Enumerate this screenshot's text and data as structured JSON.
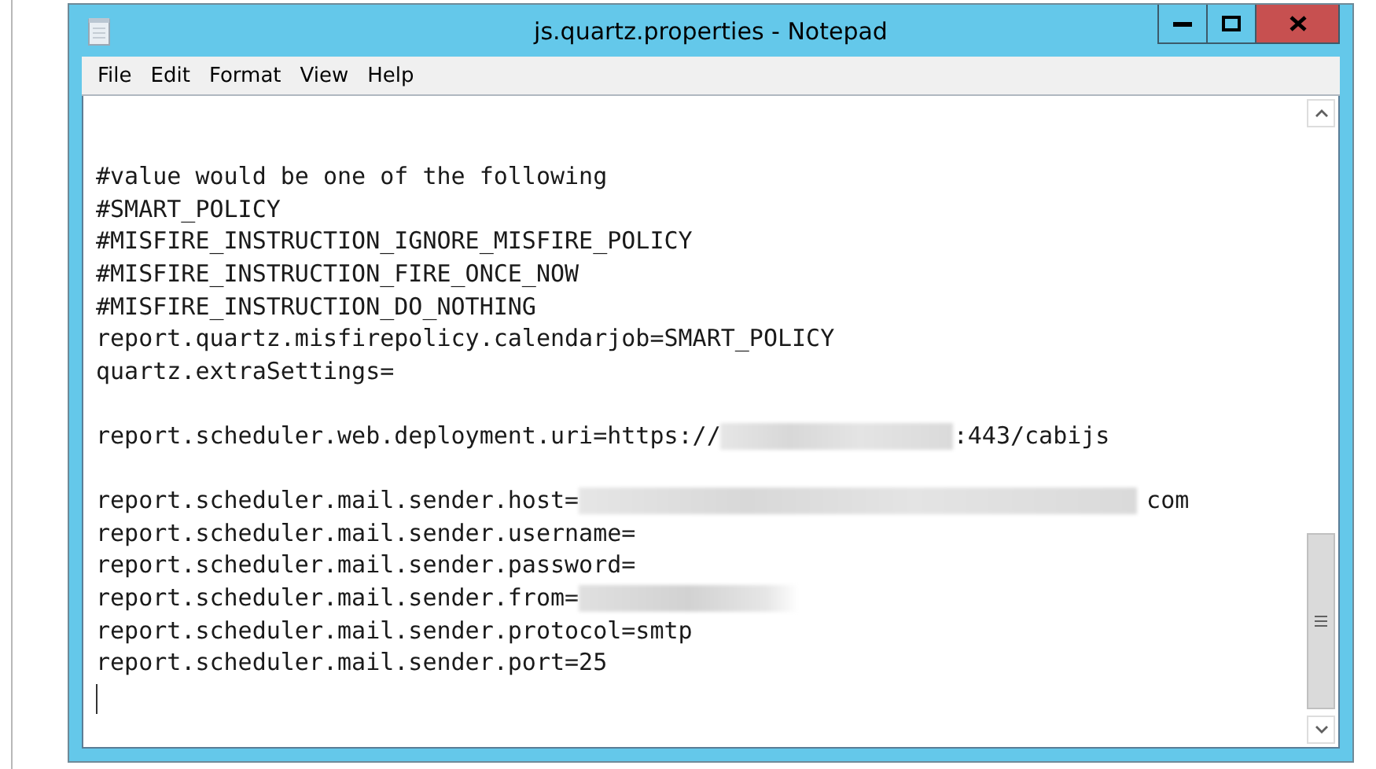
{
  "window": {
    "title": "js.quartz.properties - Notepad"
  },
  "menu": [
    "File",
    "Edit",
    "Format",
    "View",
    "Help"
  ],
  "editor": {
    "lines": [
      {
        "kind": "blank"
      },
      {
        "kind": "blank"
      },
      {
        "kind": "text",
        "segments": [
          {
            "kind": "text",
            "text": "#value would be one of the following"
          }
        ]
      },
      {
        "kind": "text",
        "segments": [
          {
            "kind": "text",
            "text": "#SMART_POLICY"
          }
        ]
      },
      {
        "kind": "text",
        "segments": [
          {
            "kind": "text",
            "text": "#MISFIRE_INSTRUCTION_IGNORE_MISFIRE_POLICY"
          }
        ]
      },
      {
        "kind": "text",
        "segments": [
          {
            "kind": "text",
            "text": "#MISFIRE_INSTRUCTION_FIRE_ONCE_NOW"
          }
        ]
      },
      {
        "kind": "text",
        "segments": [
          {
            "kind": "text",
            "text": "#MISFIRE_INSTRUCTION_DO_NOTHING"
          }
        ]
      },
      {
        "kind": "text",
        "segments": [
          {
            "kind": "text",
            "text": "report.quartz.misfirepolicy.calendarjob=SMART_POLICY"
          }
        ]
      },
      {
        "kind": "text",
        "segments": [
          {
            "kind": "text",
            "text": "quartz.extraSettings="
          }
        ]
      },
      {
        "kind": "blank"
      },
      {
        "kind": "text",
        "segments": [
          {
            "kind": "text",
            "text": "report.scheduler.web.deployment.uri=https://"
          },
          {
            "kind": "blur"
          },
          {
            "kind": "text",
            "text": ":443/cabijs"
          }
        ]
      },
      {
        "kind": "blank"
      },
      {
        "kind": "text",
        "segments": [
          {
            "kind": "text",
            "text": "report.scheduler.mail.sender.host="
          },
          {
            "kind": "wideblur"
          },
          {
            "kind": "text",
            "text": "com"
          }
        ]
      },
      {
        "kind": "text",
        "segments": [
          {
            "kind": "text",
            "text": "report.scheduler.mail.sender.username="
          }
        ]
      },
      {
        "kind": "text",
        "segments": [
          {
            "kind": "text",
            "text": "report.scheduler.mail.sender.password="
          }
        ]
      },
      {
        "kind": "text",
        "segments": [
          {
            "kind": "text",
            "text": "report.scheduler.mail.sender.from="
          },
          {
            "kind": "fadeblur"
          }
        ]
      },
      {
        "kind": "text",
        "segments": [
          {
            "kind": "text",
            "text": "report.scheduler.mail.sender.protocol=smtp"
          }
        ]
      },
      {
        "kind": "text",
        "segments": [
          {
            "kind": "text",
            "text": "report.scheduler.mail.sender.port=25"
          }
        ]
      },
      {
        "kind": "cursor"
      }
    ]
  }
}
